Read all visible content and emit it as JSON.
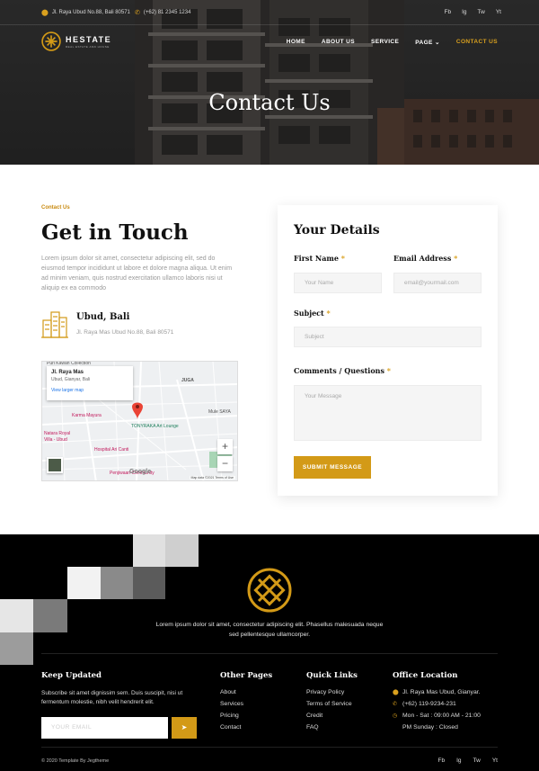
{
  "topbar": {
    "address": "Jl. Raya Ubud No.88, Bali 80571",
    "phone": "(+62) 81 2345 1234",
    "social": [
      "Fb",
      "Ig",
      "Tw",
      "Yt"
    ]
  },
  "brand": {
    "name": "HESTATE",
    "tagline": "REAL ESTATE AND HOUSE",
    "accent": "#d39a17"
  },
  "nav": {
    "items": [
      "HOME",
      "ABOUT US",
      "SERVICE",
      "PAGE",
      "CONTACT US"
    ],
    "active": "CONTACT US"
  },
  "hero": {
    "title": "Contact Us"
  },
  "contact": {
    "eyebrow": "Contact Us",
    "heading": "Get in Touch",
    "lead": "Lorem ipsum dolor sit amet, consectetur adipiscing elit, sed do eiusmod tempor incididunt ut labore et dolore magna aliqua. Ut enim ad minim veniam, quis nostrud exercitation ullamco laboris nisi ut aliquip ex ea commodo",
    "city": "Ubud, Bali",
    "address": "Jl. Raya Mas Ubud No.88, Bali 80571"
  },
  "map": {
    "card_title": "Jl. Raya Mas",
    "card_sub": "Ubud, Gianyar, Bali",
    "card_link": "View larger map",
    "labels": {
      "puri": "Puri Kawan Collection",
      "juga": "JUGA",
      "karma": "Karma Mayura",
      "tonyraka": "TONYRAKA Art Lounge",
      "mule": "Mule SAYA",
      "natara": "Natara Royal",
      "natara2": "Villa - Ubud",
      "hospital": "Hospital Ari Canti",
      "penjiwaan": "Penjiwaan Community",
      "google": "Google",
      "footer": "Map data ©2021   Terms of Use"
    },
    "zoom_in": "+",
    "zoom_out": "−"
  },
  "form": {
    "title": "Your Details",
    "first_name_label": "First Name",
    "first_name_placeholder": "Your Name",
    "email_label": "Email Address",
    "email_placeholder": "email@yourmail.com",
    "subject_label": "Subject",
    "subject_placeholder": "Subject",
    "comments_label": "Comments / Questions",
    "comments_placeholder": "Your Message",
    "required_mark": "*",
    "submit": "SUBMIT MESSAGE"
  },
  "footer": {
    "text": "Lorem ipsum dolor sit amet, consectetur adipiscing elit. Phasellus malesuada neque sed pellentesque ullamcorper.",
    "keep_updated": {
      "title": "Keep Updated",
      "text": "Subscribe sit amet dignissim sem. Duis suscipit, nisi ut fermentum molestie, nibh velit hendrerit elit.",
      "placeholder": "YOUR EMAIL"
    },
    "other_pages": {
      "title": "Other Pages",
      "items": [
        "About",
        "Services",
        "Pricing",
        "Contact"
      ]
    },
    "quick_links": {
      "title": "Quick Links",
      "items": [
        "Privacy Policy",
        "Terms of Service",
        "Credit",
        "FAQ"
      ]
    },
    "office": {
      "title": "Office Location",
      "address": "Jl. Raya Mas Ubud, Gianyar.",
      "phone": "(+62) 119-9234-231",
      "hours1": "Mon - Sat : 09:00 AM - 21:00",
      "hours2": "PM Sunday : Closed"
    },
    "copyright": "© 2020 Template By Jegtheme",
    "social": [
      "Fb",
      "Ig",
      "Tw",
      "Yt"
    ]
  }
}
